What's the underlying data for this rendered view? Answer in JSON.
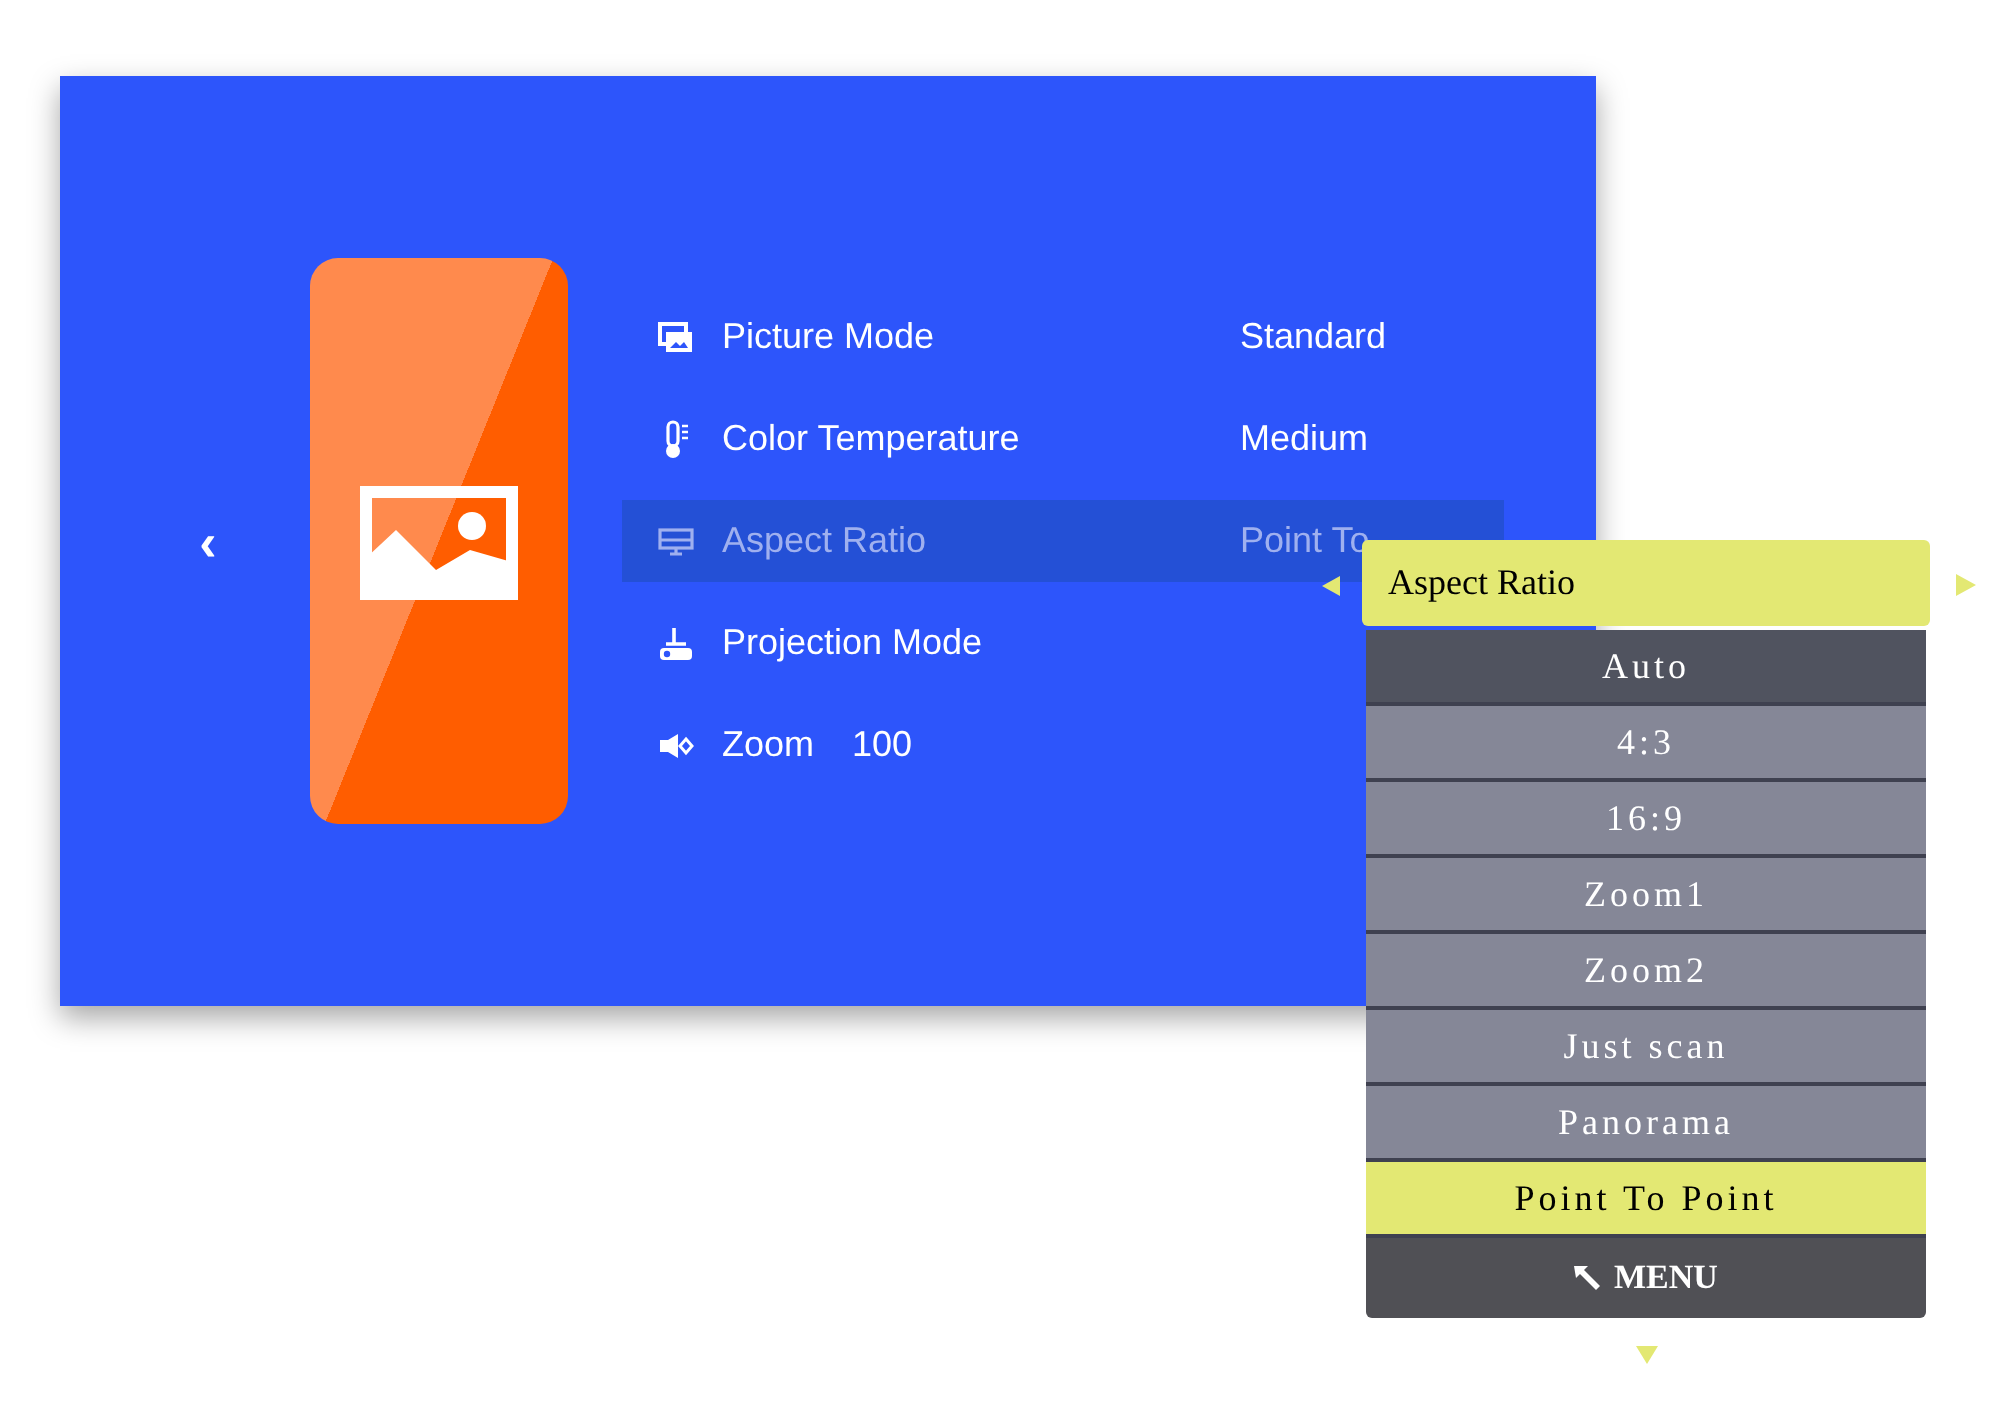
{
  "back_button": {
    "label": "‹"
  },
  "settings": [
    {
      "kind": "picture",
      "label": "Picture Mode",
      "value": "Standard",
      "selected": false
    },
    {
      "kind": "temperature",
      "label": "Color Temperature",
      "value": "Medium",
      "selected": false
    },
    {
      "kind": "screen",
      "label": "Aspect Ratio",
      "value": "Point To",
      "selected": true
    },
    {
      "kind": "projector",
      "label": "Projection Mode",
      "selected": false
    },
    {
      "kind": "speaker",
      "label": "Zoom",
      "value": "100",
      "selected": false
    }
  ],
  "popup": {
    "title": "Aspect Ratio",
    "options": [
      {
        "label": "Auto",
        "selected": false,
        "focused": true
      },
      {
        "label": "4:3",
        "selected": false,
        "focused": false
      },
      {
        "label": "16:9",
        "selected": false,
        "focused": false
      },
      {
        "label": "Zoom1",
        "selected": false,
        "focused": false
      },
      {
        "label": "Zoom2",
        "selected": false,
        "focused": false
      },
      {
        "label": "Just scan",
        "selected": false,
        "focused": false
      },
      {
        "label": "Panorama",
        "selected": false,
        "focused": false
      },
      {
        "label": "Point To Point",
        "selected": true,
        "focused": false
      }
    ],
    "menu_button": {
      "label": "MENU"
    }
  }
}
